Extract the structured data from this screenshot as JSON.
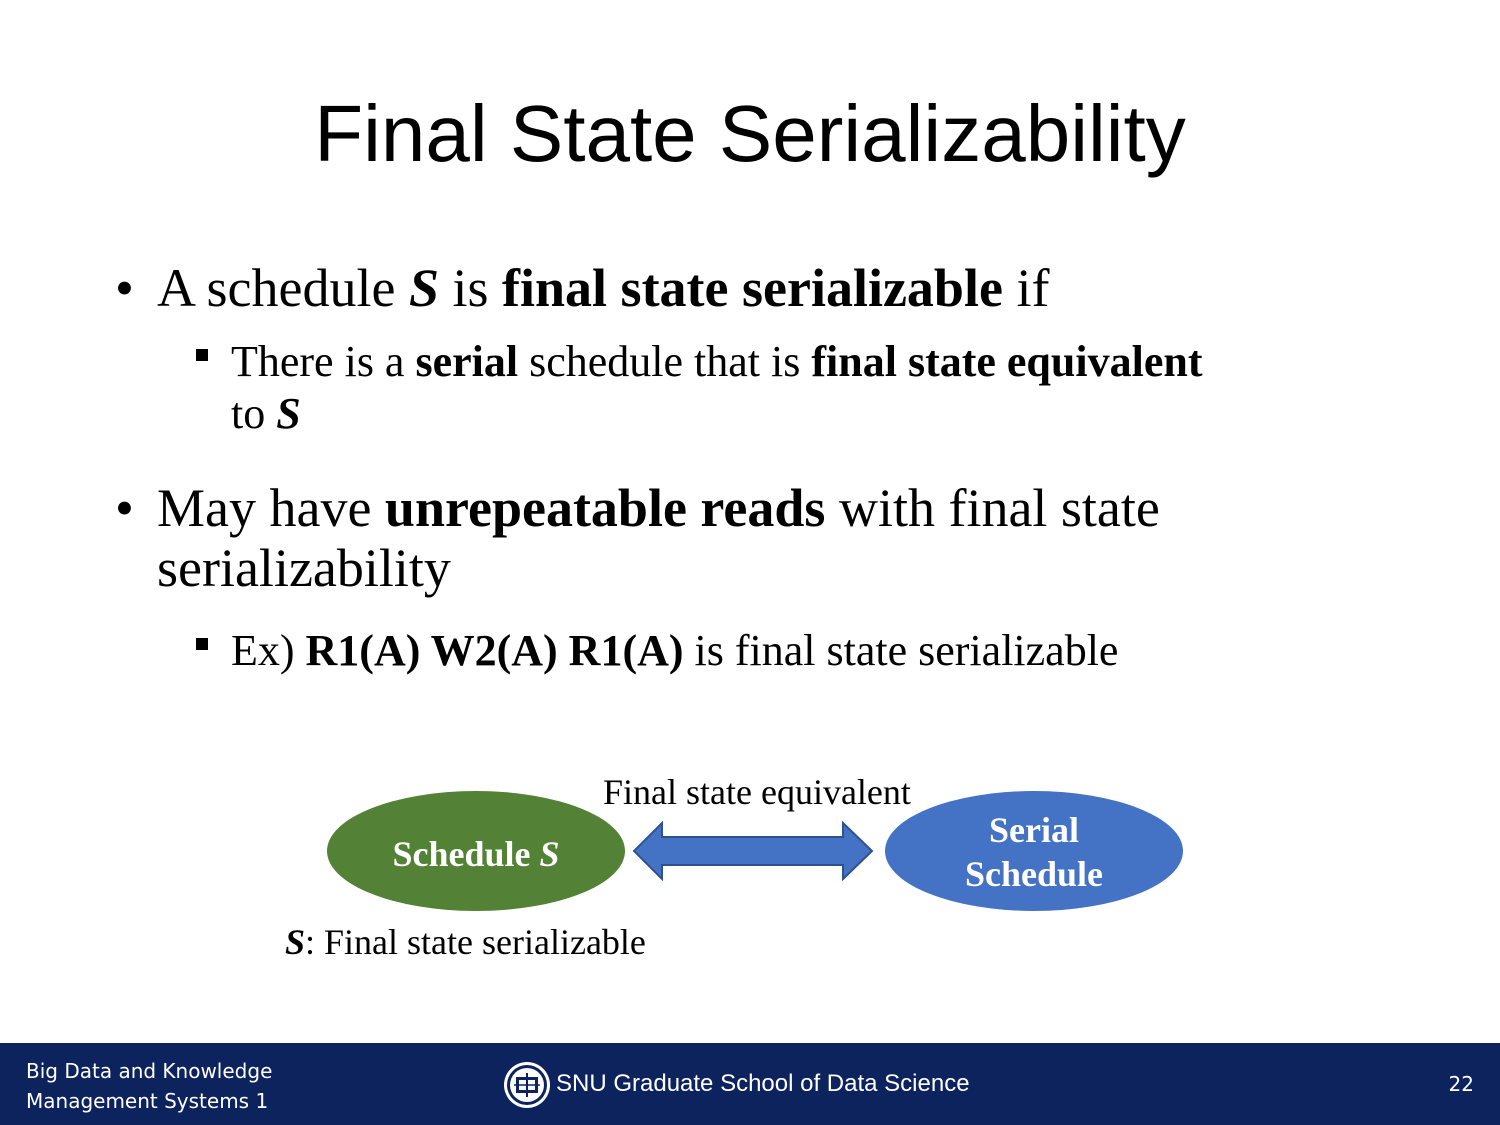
{
  "slide": {
    "title": "Final State Serializability"
  },
  "bullets": [
    {
      "parts": [
        "A schedule ",
        "S",
        " is ",
        "final state serializable",
        " if"
      ],
      "sub": {
        "parts": [
          "There is a ",
          "serial",
          " schedule that is ",
          "final state equivalent",
          "to ",
          "S"
        ]
      }
    },
    {
      "parts": [
        "May have ",
        "unrepeatable reads",
        " with final state",
        "serializability"
      ],
      "sub": {
        "parts": [
          "Ex) ",
          "R1(A) W2(A) R1(A)",
          " is final state serializable"
        ]
      }
    }
  ],
  "diagram": {
    "edge_label": "Final state equivalent",
    "node_schedule": {
      "label": "Schedule ",
      "var": "S",
      "color": "#538135"
    },
    "node_serial": {
      "line1": "Serial",
      "line2": "Schedule",
      "color": "#4472c4"
    },
    "arrow_color": "#4472c4",
    "caption": {
      "var": "S",
      "text": ": Final state serializable"
    }
  },
  "footer": {
    "course_line1": "Big Data and Knowledge",
    "course_line2": "Management Systems 1",
    "school": "SNU Graduate School of Data Science",
    "page": "22",
    "bg_color": "#0d235e",
    "logo_icon": "snu-emblem-icon"
  }
}
